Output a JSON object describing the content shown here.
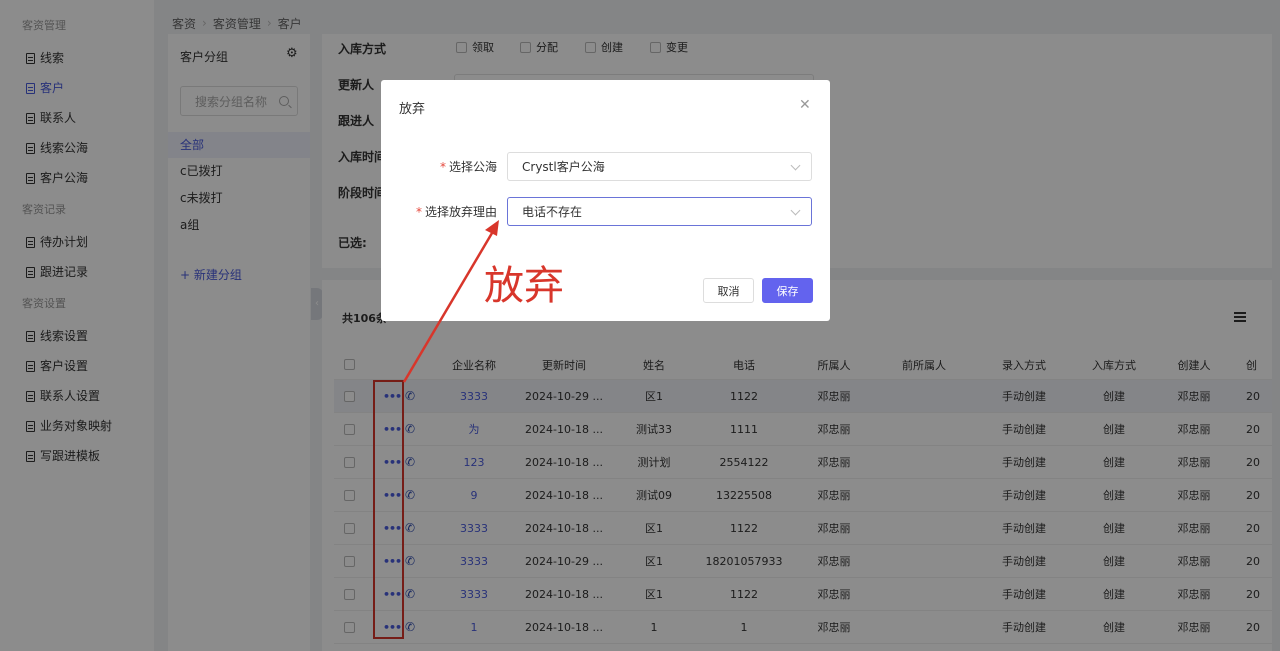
{
  "sidebar": {
    "groups": [
      {
        "label": "客资管理",
        "items": [
          {
            "label": "线索"
          },
          {
            "label": "客户",
            "active": true
          },
          {
            "label": "联系人"
          },
          {
            "label": "线索公海"
          },
          {
            "label": "客户公海"
          }
        ]
      },
      {
        "label": "客资记录",
        "items": [
          {
            "label": "待办计划"
          },
          {
            "label": "跟进记录"
          }
        ]
      },
      {
        "label": "客资设置",
        "items": [
          {
            "label": "线索设置"
          },
          {
            "label": "客户设置"
          },
          {
            "label": "联系人设置"
          },
          {
            "label": "业务对象映射"
          },
          {
            "label": "写跟进模板"
          }
        ]
      }
    ]
  },
  "breadcrumb": [
    "客资",
    "客资管理",
    "客户"
  ],
  "group_panel": {
    "title": "客户分组",
    "search_placeholder": "搜索分组名称",
    "items": [
      "全部",
      "c已拨打",
      "c未拨打",
      "a组"
    ],
    "new_group": "+ 新建分组"
  },
  "filters": {
    "storage_method_label": "入库方式",
    "storage_options": [
      "领取",
      "分配",
      "创建",
      "变更"
    ],
    "updater_label": "更新人",
    "follower_label": "跟进人",
    "storage_time_label": "入库时间",
    "stage_time_label": "阶段时间",
    "selected_label": "已选:"
  },
  "table": {
    "total_text": "共106条",
    "headers": [
      "企业名称",
      "更新时间",
      "姓名",
      "电话",
      "所属人",
      "前所属人",
      "录入方式",
      "入库方式",
      "创建人",
      "创"
    ],
    "rows": [
      [
        "3333",
        "2024-10-29 ...",
        "区1",
        "1122",
        "邓忠丽",
        "",
        "手动创建",
        "创建",
        "邓忠丽",
        "20"
      ],
      [
        "为",
        "2024-10-18 ...",
        "测试33",
        "1111",
        "邓忠丽",
        "",
        "手动创建",
        "创建",
        "邓忠丽",
        "20"
      ],
      [
        "123",
        "2024-10-18 ...",
        "测计划",
        "2554122",
        "邓忠丽",
        "",
        "手动创建",
        "创建",
        "邓忠丽",
        "20"
      ],
      [
        "9",
        "2024-10-18 ...",
        "测试09",
        "13225508",
        "邓忠丽",
        "",
        "手动创建",
        "创建",
        "邓忠丽",
        "20"
      ],
      [
        "3333",
        "2024-10-18 ...",
        "区1",
        "1122",
        "邓忠丽",
        "",
        "手动创建",
        "创建",
        "邓忠丽",
        "20"
      ],
      [
        "3333",
        "2024-10-29 ...",
        "区1",
        "18201057933",
        "邓忠丽",
        "",
        "手动创建",
        "创建",
        "邓忠丽",
        "20"
      ],
      [
        "3333",
        "2024-10-18 ...",
        "区1",
        "1122",
        "邓忠丽",
        "",
        "手动创建",
        "创建",
        "邓忠丽",
        "20"
      ],
      [
        "1",
        "2024-10-18 ...",
        "1",
        "1",
        "邓忠丽",
        "",
        "手动创建",
        "创建",
        "邓忠丽",
        "20"
      ]
    ]
  },
  "modal": {
    "title": "放弃",
    "sea_label": "选择公海",
    "sea_value": "Crystl客户公海",
    "reason_label": "选择放弃理由",
    "reason_value": "电话不存在",
    "required_mark": "*",
    "cancel": "取消",
    "save": "保存"
  },
  "annotation": {
    "text": "放弃",
    "color": "#d8362b"
  },
  "colors": {
    "accent": "#4a5bdc",
    "save_button": "#6363ee",
    "required": "#e5483c"
  }
}
